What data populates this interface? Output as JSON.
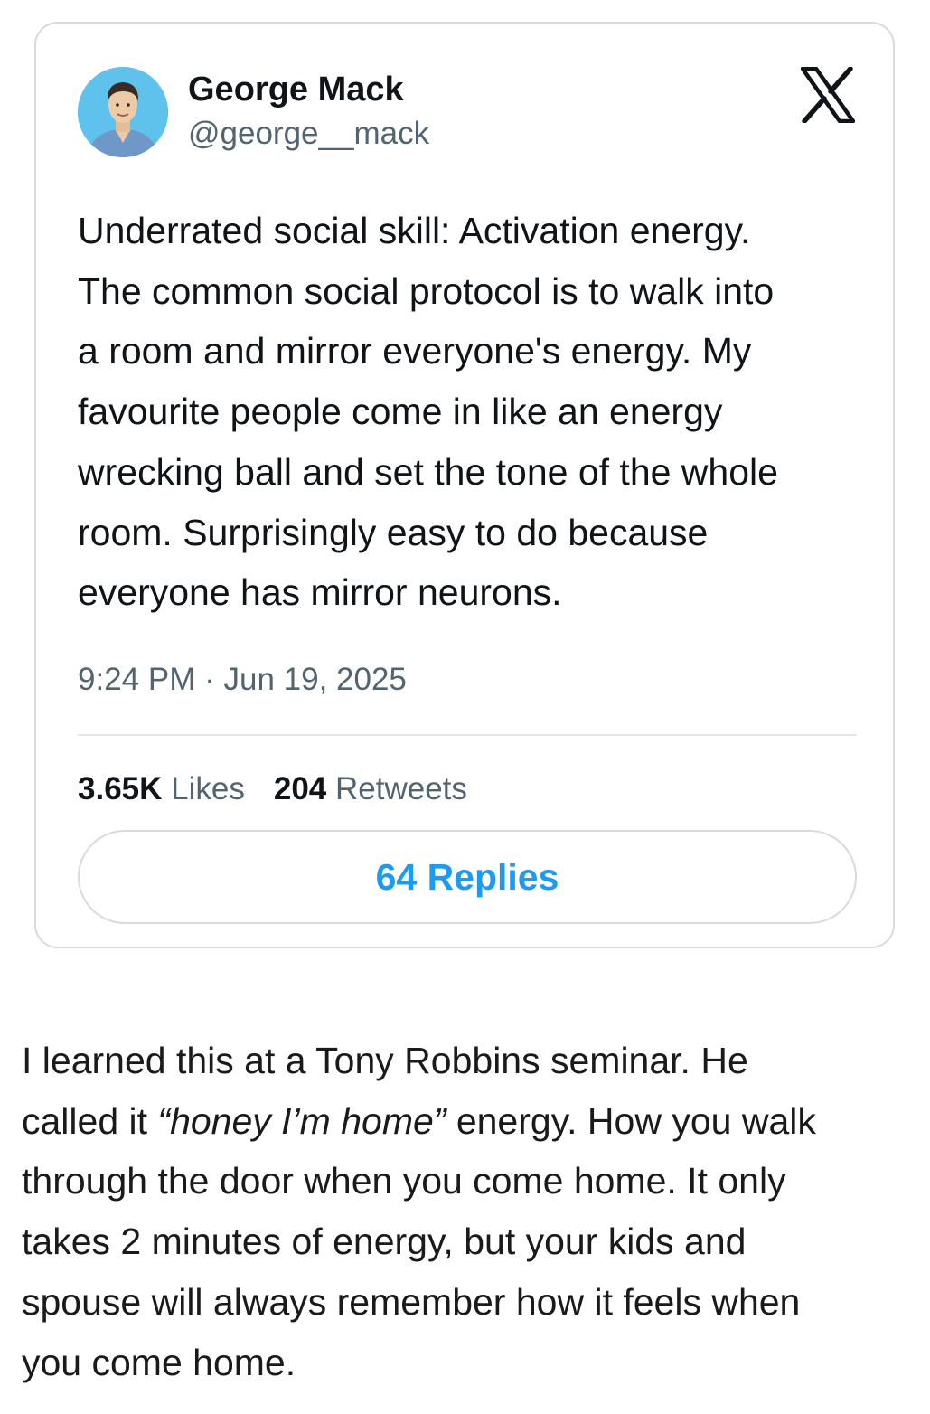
{
  "tweet": {
    "author_name": "George Mack",
    "author_handle": "@george__mack",
    "platform_icon": "x-logo-icon",
    "text_lines": [
      "Underrated social skill: Activation energy.",
      "The common social protocol is to walk into",
      "a room and mirror everyone's energy. My",
      "favourite people come in like an energy",
      "wrecking ball and set the tone of the whole",
      "room. Surprisingly easy to do because",
      "everyone has mirror neurons."
    ],
    "time": "9:24 PM",
    "separator": "·",
    "date": "Jun 19, 2025",
    "likes_count": "3.65K",
    "likes_label": "Likes",
    "retweets_count": "204",
    "retweets_label": "Retweets",
    "replies_label": "64 Replies"
  },
  "caption": {
    "line1": "I learned this at a Tony Robbins seminar. He",
    "line2_start": "called it ",
    "line2_italic": "“honey I’m home”",
    "line2_end": " energy. How you walk",
    "line3": "through the door when you come home. It only",
    "line4": "takes 2 minutes of energy, but your kids and",
    "line5": "spouse will always remember how it feels when",
    "line6": "you come home."
  },
  "colors": {
    "accent": "#1d9bf0",
    "secondary_text": "#536471",
    "border": "#d6dbe0",
    "avatar_bg": "#5fc2ec"
  }
}
